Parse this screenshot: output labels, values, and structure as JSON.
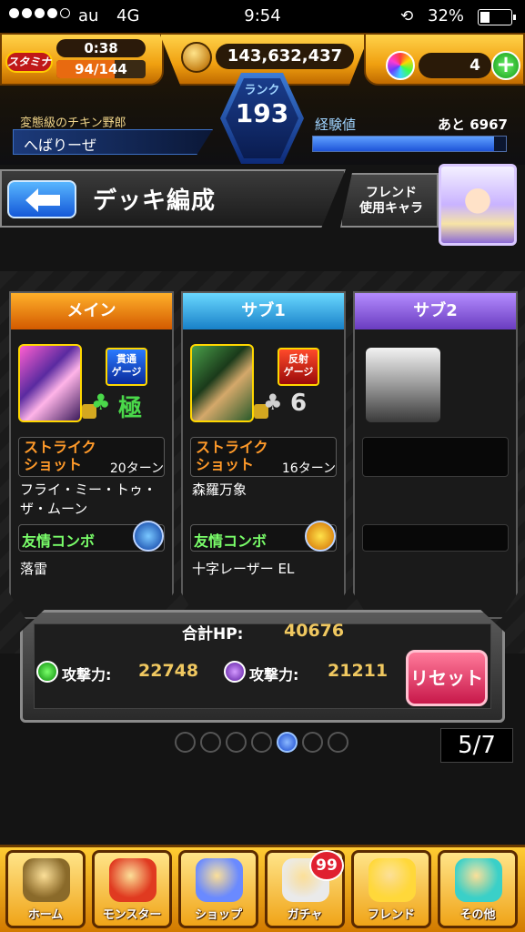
{
  "status_bar": {
    "carrier": "au",
    "network": "4G",
    "time": "9:54",
    "battery": "32%",
    "battery_level": 0.32,
    "signal_bars_filled": 4,
    "signal_bars_total": 5
  },
  "hud": {
    "stamina_label": "スタミナ",
    "stamina_timer": "0:38",
    "stamina_value": "94/144",
    "stamina_fraction": 0.653,
    "coins": "143,632,437",
    "orbs": "4",
    "add_label": "+",
    "rank_label": "ランク",
    "rank": "193",
    "player_title": "変態級のチキン野郎",
    "player_name": "へばりーぜ",
    "exp_label": "経験値",
    "exp_remaining": "あと 6967",
    "exp_fraction": 0.94
  },
  "header": {
    "title": "デッキ編成",
    "friend_label_line1": "フレンド",
    "friend_label_line2": "使用キャラ"
  },
  "deck": {
    "main": {
      "tab": "メイン",
      "ability_line1": "貫通",
      "ability_line2": "ゲージ",
      "luck": "極",
      "skill_line1": "ストライク",
      "skill_line2": "ショット",
      "skill_turns": "20ターン",
      "name": "フライ・ミー・トゥ・ザ・ムーン",
      "combo_label": "友情コンボ",
      "combo_name": "落雷"
    },
    "sub1": {
      "tab": "サブ1",
      "ability_line1": "反射",
      "ability_line2": "ゲージ",
      "luck": "6",
      "skill_line1": "ストライク",
      "skill_line2": "ショット",
      "skill_turns": "16ターン",
      "name": "森羅万象",
      "combo_label": "友情コンボ",
      "combo_name": "十字レーザー EL"
    },
    "sub2": {
      "tab": "サブ2"
    }
  },
  "totals": {
    "hp_label": "合計HP:",
    "hp_value": "40676",
    "atk_label": "攻撃力:",
    "atk1_value": "22748",
    "atk2_value": "21211",
    "reset_label": "リセット"
  },
  "pager": {
    "count_text": "5/7",
    "current": 5,
    "total": 7
  },
  "nav": {
    "items": [
      {
        "label": "ホーム",
        "icon": "home-icon",
        "color": "#8a6a2a"
      },
      {
        "label": "モンスター",
        "icon": "monster-icon",
        "color": "#e03a20"
      },
      {
        "label": "ショップ",
        "icon": "orb-icon",
        "color": "#6a8aff"
      },
      {
        "label": "ガチャ",
        "icon": "egg-icon",
        "color": "#eaeaea"
      },
      {
        "label": "フレンド",
        "icon": "friends-icon",
        "color": "#ffd83a"
      },
      {
        "label": "その他",
        "icon": "map-icon",
        "color": "#3ad0c8"
      }
    ],
    "gacha_badge": "99"
  },
  "colors": {
    "accent_orange": "#f0a010",
    "accent_blue": "#1458d8",
    "reset_pink": "#c8184a",
    "combo_green": "#7aff6a"
  }
}
